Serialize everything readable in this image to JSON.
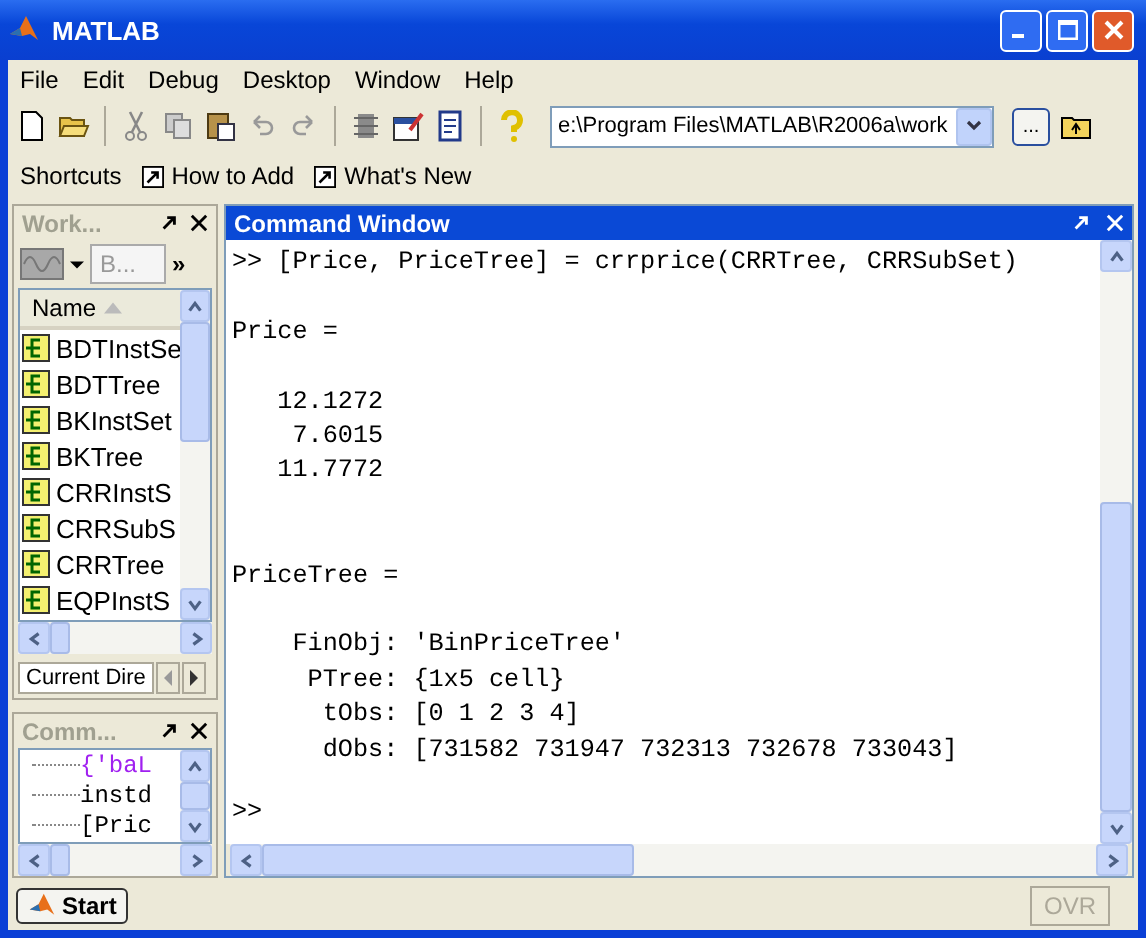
{
  "window": {
    "title": "MATLAB"
  },
  "menu": [
    "File",
    "Edit",
    "Debug",
    "Desktop",
    "Window",
    "Help"
  ],
  "toolbar": {
    "current_directory": "e:\\Program Files\\MATLAB\\R2006a\\work",
    "browse_label": "..."
  },
  "shortcuts": {
    "label": "Shortcuts",
    "items": [
      "How to Add",
      "What's New"
    ]
  },
  "workspace": {
    "title": "Work...",
    "field": "B...",
    "more": "»",
    "column": "Name",
    "variables": [
      "BDTInstSe",
      "BDTTree",
      "BKInstSet",
      "BKTree",
      "CRRInstS",
      "CRRSubS",
      "CRRTree",
      "EQPInstS"
    ],
    "tab": "Current Dire"
  },
  "command_history": {
    "title": "Comm...",
    "items": [
      {
        "text": "{'baL",
        "kind": "string"
      },
      {
        "text": "instd",
        "kind": "code"
      },
      {
        "text": "[Pric",
        "kind": "code"
      }
    ]
  },
  "command_window": {
    "title": "Command Window",
    "command": ">> [Price, PriceTree] = crrprice(CRRTree, CRRSubSet)",
    "output": "Price =\n\n   12.1272\n    7.6015\n   11.7772\n\n\nPriceTree =\n\n    FinObj: 'BinPriceTree'\n     PTree: {1x5 cell}\n      tObs: [0 1 2 3 4]\n      dObs: [731582 731947 732313 732678 733043]",
    "prompt": ">>"
  },
  "taskbar": {
    "start": "Start",
    "status": "OVR"
  }
}
